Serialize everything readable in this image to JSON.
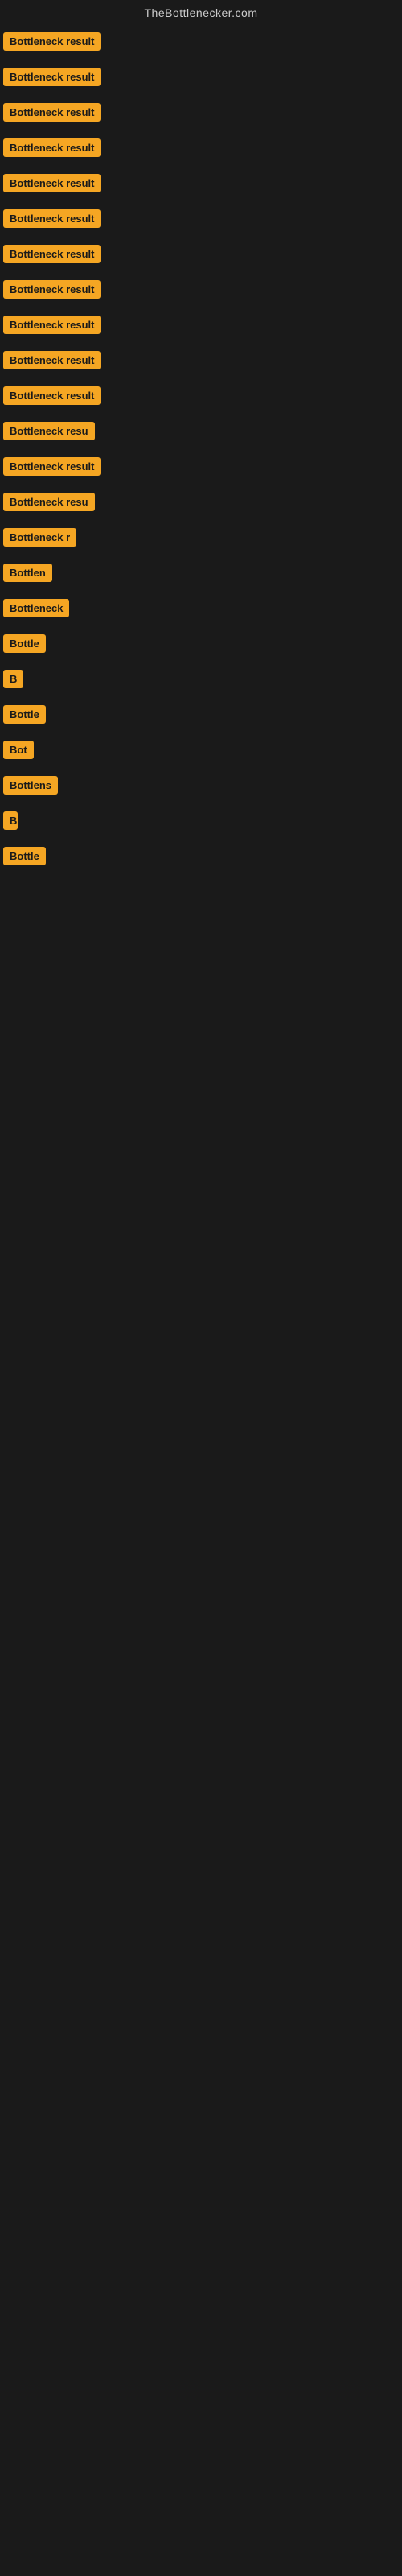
{
  "site": {
    "title": "TheBottlenecker.com"
  },
  "badges": [
    {
      "id": 1,
      "label": "Bottleneck result",
      "row_class": "row-1"
    },
    {
      "id": 2,
      "label": "Bottleneck result",
      "row_class": "row-2"
    },
    {
      "id": 3,
      "label": "Bottleneck result",
      "row_class": "row-3"
    },
    {
      "id": 4,
      "label": "Bottleneck result",
      "row_class": "row-4"
    },
    {
      "id": 5,
      "label": "Bottleneck result",
      "row_class": "row-5"
    },
    {
      "id": 6,
      "label": "Bottleneck result",
      "row_class": "row-6"
    },
    {
      "id": 7,
      "label": "Bottleneck result",
      "row_class": "row-7"
    },
    {
      "id": 8,
      "label": "Bottleneck result",
      "row_class": "row-8"
    },
    {
      "id": 9,
      "label": "Bottleneck result",
      "row_class": "row-9"
    },
    {
      "id": 10,
      "label": "Bottleneck result",
      "row_class": "row-10"
    },
    {
      "id": 11,
      "label": "Bottleneck result",
      "row_class": "row-11"
    },
    {
      "id": 12,
      "label": "Bottleneck resu",
      "row_class": "row-12"
    },
    {
      "id": 13,
      "label": "Bottleneck result",
      "row_class": "row-13"
    },
    {
      "id": 14,
      "label": "Bottleneck resu",
      "row_class": "row-14"
    },
    {
      "id": 15,
      "label": "Bottleneck r",
      "row_class": "row-15"
    },
    {
      "id": 16,
      "label": "Bottlen",
      "row_class": "row-16"
    },
    {
      "id": 17,
      "label": "Bottleneck",
      "row_class": "row-17"
    },
    {
      "id": 18,
      "label": "Bottle",
      "row_class": "row-18"
    },
    {
      "id": 19,
      "label": "B",
      "row_class": "row-19"
    },
    {
      "id": 20,
      "label": "Bottle",
      "row_class": "row-20"
    },
    {
      "id": 21,
      "label": "Bot",
      "row_class": "row-21"
    },
    {
      "id": 22,
      "label": "Bottlens",
      "row_class": "row-22"
    },
    {
      "id": 23,
      "label": "B",
      "row_class": "row-23"
    },
    {
      "id": 24,
      "label": "Bottle",
      "row_class": "row-24"
    }
  ]
}
